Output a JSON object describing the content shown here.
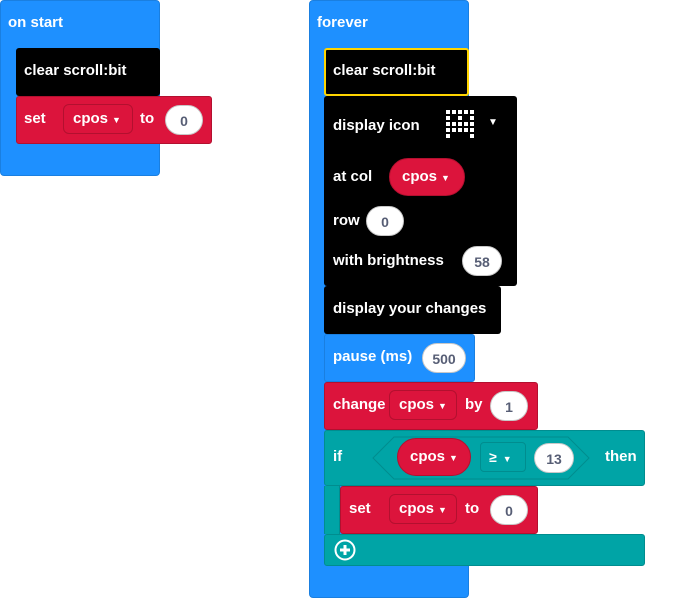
{
  "on_start": {
    "hat_label": "on start",
    "clear_label": "clear scroll:bit",
    "set_label": "set",
    "var_name": "cpos",
    "to_label": "to",
    "value": "0"
  },
  "forever": {
    "hat_label": "forever",
    "clear_label": "clear scroll:bit",
    "display_icon": {
      "label": "display icon",
      "at_col_label": "at col",
      "col_var": "cpos",
      "row_label": "row",
      "row_value": "0",
      "brightness_label": "with brightness",
      "brightness_value": "58"
    },
    "display_changes_label": "display your changes",
    "pause": {
      "label": "pause (ms)",
      "value": "500"
    },
    "change": {
      "label": "change",
      "var_name": "cpos",
      "by_label": "by",
      "value": "1"
    },
    "if_block": {
      "if_label": "if",
      "var_name": "cpos",
      "operator": "≥",
      "compare_value": "13",
      "then_label": "then",
      "set_label": "set",
      "set_var": "cpos",
      "to_label": "to",
      "set_value": "0"
    }
  },
  "colors": {
    "events_blue": "#1e90ff",
    "scrollbit_black": "#000000",
    "variables_red": "#dc143c",
    "logic_teal": "#00a4a6",
    "selected_outline": "#ffd500"
  }
}
